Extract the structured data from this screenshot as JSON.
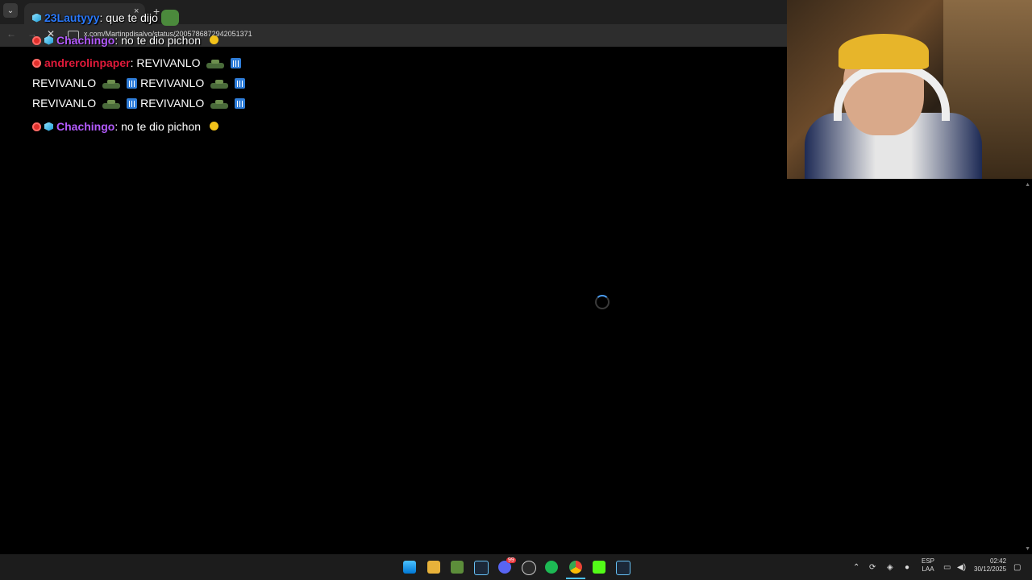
{
  "browser": {
    "tab_list_icon": "chevron-down-icon",
    "tab_close": "×",
    "new_tab": "+",
    "back": "←",
    "forward": "→",
    "stop": "✕",
    "url": "x.com/Martinpdisalvo/status/2005786872942051371"
  },
  "chat": {
    "messages": [
      {
        "user": "23Lautyyy",
        "text": ": que te dijo"
      },
      {
        "user": "Chachingo",
        "text": ": no te dio pichon"
      },
      {
        "user": "andrerolinpaper",
        "text": ": REVIVANLO"
      },
      {
        "spam": [
          "REVIVANLO",
          "REVIVANLO"
        ]
      },
      {
        "spam": [
          "REVIVANLO",
          "REVIVANLO"
        ]
      },
      {
        "user": "Chachingo",
        "text": ": no te dio pichon"
      }
    ]
  },
  "taskbar": {
    "lang_top": "ESP",
    "lang_bottom": "LAA",
    "time": "02:42",
    "date": "30/12/2025",
    "discord_badge": "99"
  },
  "colors": {
    "accent": "#2b7bff",
    "purple_user": "#b45bff",
    "red_user": "#e01a3a"
  }
}
